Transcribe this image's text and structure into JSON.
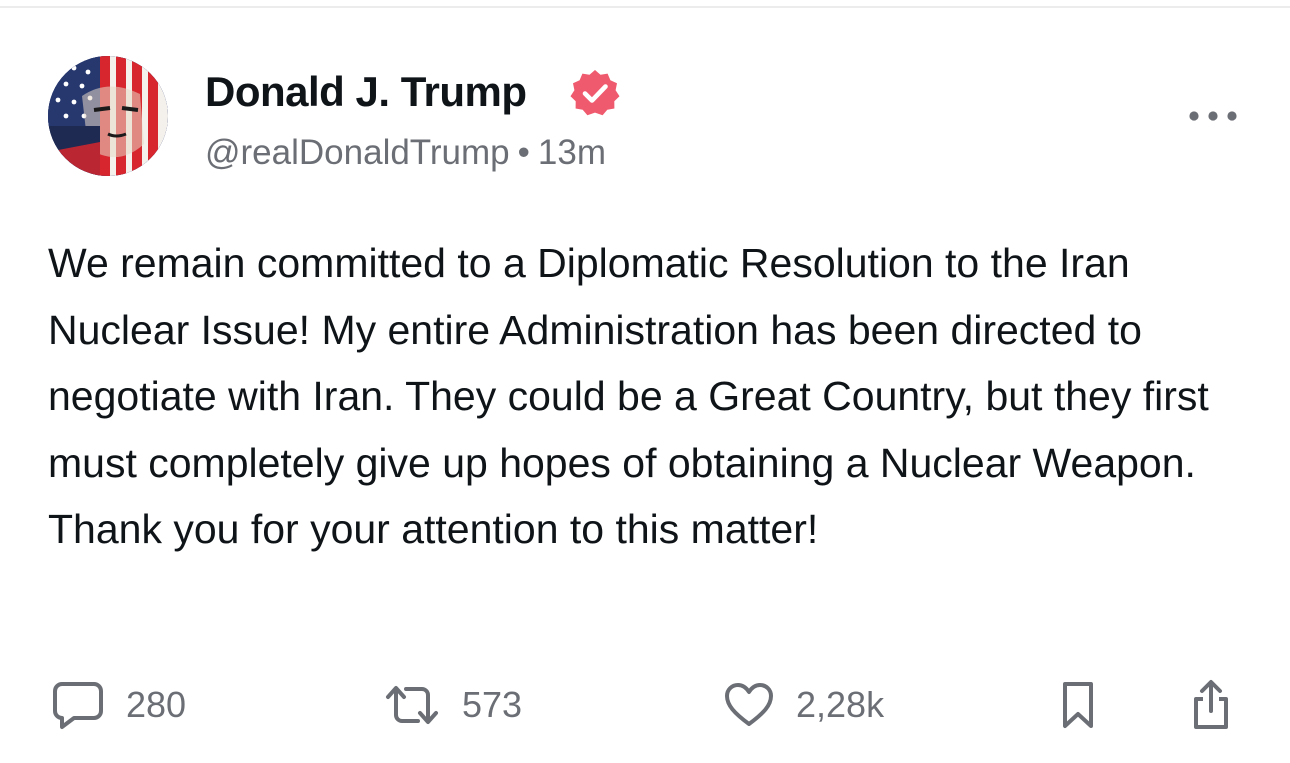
{
  "author": {
    "name": "Donald J. Trump",
    "handle": "@realDonaldTrump",
    "separator": "•",
    "time": "13m",
    "verified_color": "#f05a6e"
  },
  "post": {
    "text": "We remain committed to a Diplomatic Resolution to the Iran Nuclear Issue! My entire Administration has been directed to negotiate with Iran. They could be a Great Country, but they first must completely give up hopes of obtaining a Nuclear Weapon. Thank you for your attention to this matter!"
  },
  "actions": {
    "comments": "280",
    "reposts": "573",
    "likes": "2,28k"
  },
  "icons": {
    "more": "more-horizontal-icon",
    "comment": "comment-bubble-icon",
    "repost": "repost-arrows-icon",
    "like": "heart-icon",
    "bookmark": "bookmark-icon",
    "share": "share-icon",
    "verified": "verified-badge-icon"
  },
  "colors": {
    "text": "#0f1419",
    "muted": "#6b6f75",
    "divider": "#ececec"
  }
}
